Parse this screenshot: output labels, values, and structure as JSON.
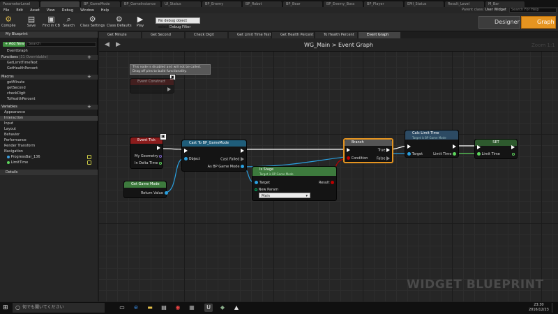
{
  "doc_tabs": [
    "ParameterLevel",
    "",
    "BP_GameMode",
    "BP_GameInstance",
    "UI_Status",
    "BP_Enemy",
    "BP_Robot",
    "BP_Bear",
    "BP_Enemy_Boss",
    "BP_Player",
    "EMI_Status",
    "Result_Level",
    "M_Bar"
  ],
  "menu": [
    "File",
    "Edit",
    "Asset",
    "View",
    "Debug",
    "Window",
    "Help"
  ],
  "parent_class": {
    "label": "Parent class:",
    "value": "User Widget"
  },
  "search_help_placeholder": "Search For Help",
  "toolbar": {
    "compile": "Compile",
    "save": "Save",
    "find": "Find in CB",
    "search": "Search",
    "class_settings": "Class Settings",
    "class_defaults": "Class Defaults",
    "play": "Play",
    "debug_select": "No debug object selected",
    "debug_filter": "Debug Filter"
  },
  "mode": {
    "designer": "Designer",
    "graph": "Graph"
  },
  "left": {
    "panel_title": "My Blueprint",
    "add_new": "+ Add New",
    "search_placeholder": "Search",
    "event_graph": "EventGraph",
    "functions_label": "Functions",
    "functions_count": "(31 Overridable)",
    "functions": [
      "GetLimitTimeText",
      "GetHealthPercent"
    ],
    "macros_label": "Macros",
    "macros": [
      "getMinute",
      "getSecond",
      "checkDigit",
      "ToHealthPercent"
    ],
    "variables_label": "Variables",
    "variables": [
      "Appearance",
      "Interaction",
      "Input",
      "Layout",
      "Behavior",
      "Performance",
      "Render Transform",
      "Navigation"
    ],
    "var_items": [
      "ProgressBar_136",
      "LimitTime"
    ],
    "details_title": "Details"
  },
  "graph_tabs": [
    "Get Minute",
    "Get Second",
    "Check Digit",
    "Get Limit Time Text",
    "Get Health Percent",
    "To Health Percent",
    "Event Graph"
  ],
  "breadcrumb": "WG_Main  >  Event Graph",
  "zoom": "Zoom 1:1",
  "watermark": "WIDGET BLUEPRINT",
  "comment": "This node is disabled and will not be called.\nDrag off pins to build functionality.",
  "nodes": {
    "event_construct": "Event Construct",
    "event_tick": "Event Tick",
    "my_geometry": "My Geometry",
    "in_delta_time": "In Delta Time",
    "get_game_mode": "Get Game Mode",
    "return_value": "Return Value",
    "cast": "Cast To BP_GameMode",
    "object": "Object",
    "cast_failed": "Cast Failed",
    "as_bp": "As BP Game Mode",
    "branch": "Branch",
    "condition": "Condition",
    "true": "True",
    "false": "False",
    "is_stage": "Is Stage",
    "is_stage_sub": "Target is BP Game Mode",
    "target": "Target",
    "result": "Result",
    "new_param": "New Param",
    "new_param_value": "Main",
    "calc": "Calc Limit Time",
    "calc_sub": "Target is BP Game Mode",
    "limit_time": "Limit Time",
    "set": "SET"
  },
  "taskbar": {
    "search": "何でも聞いてください",
    "time": "23:30",
    "date": "2016/12/23"
  },
  "colors": {
    "accent": "#e59420",
    "event": "#8b1c1c",
    "pure": "#3d7a3d",
    "cast": "#1f5d7a",
    "func": "#2c4a63"
  }
}
